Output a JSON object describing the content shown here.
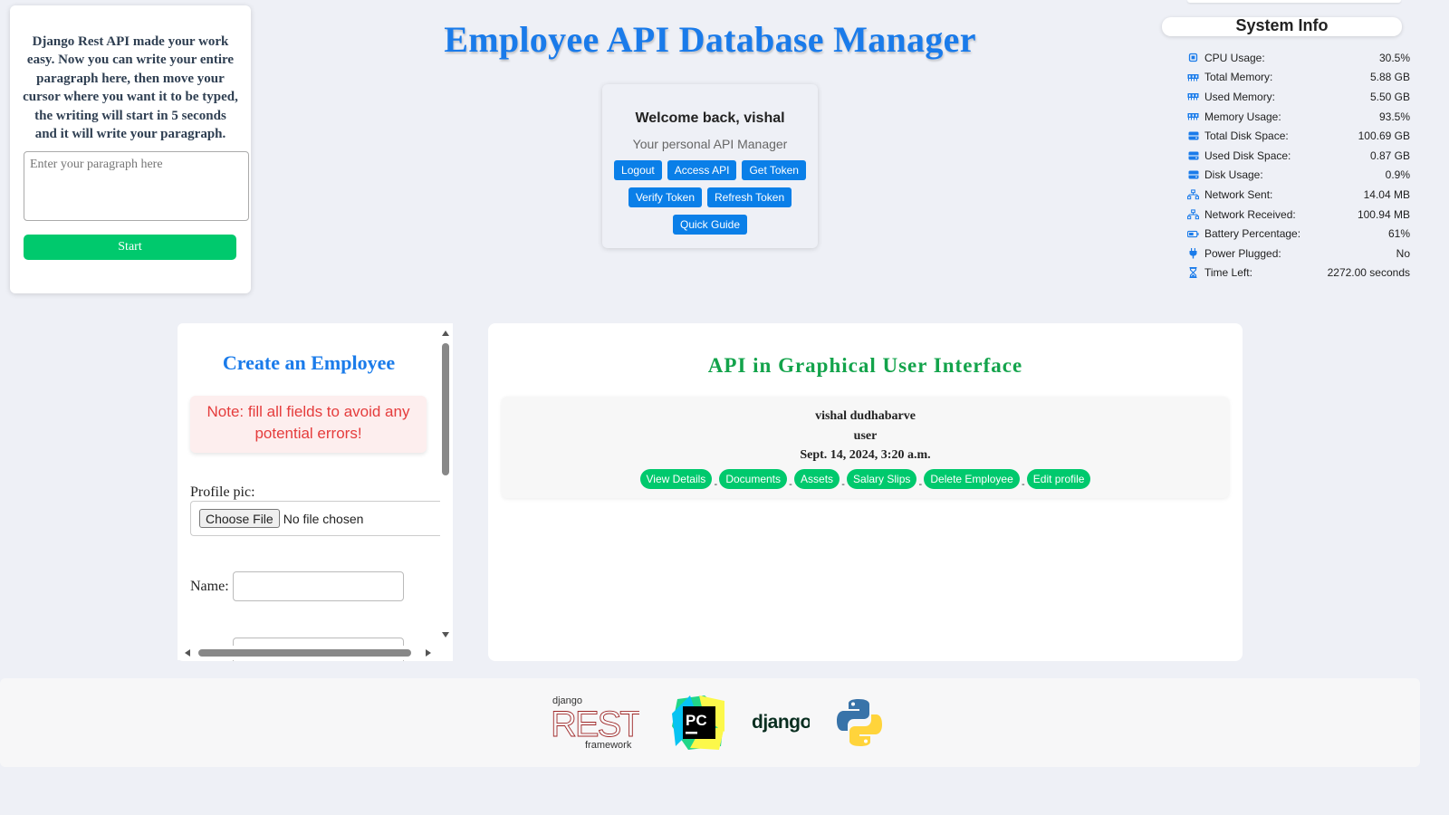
{
  "typer": {
    "description": "Django Rest API made your work easy. Now you can write your entire paragraph here, then move your cursor where you want it to be typed, the writing will start in 5 seconds and it will write your paragraph.",
    "placeholder": "Enter your paragraph here",
    "start_label": "Start"
  },
  "header": {
    "title": "Employee API Database Manager"
  },
  "welcome": {
    "title": "Welcome back, vishal",
    "subtitle": "Your personal API Manager",
    "buttons": {
      "logout": "Logout",
      "access_api": "Access API",
      "get_token": "Get Token",
      "verify_token": "Verify Token",
      "refresh_token": "Refresh Token",
      "quick_guide": "Quick Guide"
    }
  },
  "system_info": {
    "title": "System Info",
    "rows": [
      {
        "icon": "cpu-icon",
        "label": "CPU Usage:",
        "value": "30.5%"
      },
      {
        "icon": "memory-icon",
        "label": "Total Memory:",
        "value": "5.88 GB"
      },
      {
        "icon": "memory-icon",
        "label": "Used Memory:",
        "value": "5.50 GB"
      },
      {
        "icon": "memory-icon",
        "label": "Memory Usage:",
        "value": "93.5%"
      },
      {
        "icon": "disk-icon",
        "label": "Total Disk Space:",
        "value": "100.69 GB"
      },
      {
        "icon": "disk-icon",
        "label": "Used Disk Space:",
        "value": "0.87 GB"
      },
      {
        "icon": "disk-icon",
        "label": "Disk Usage:",
        "value": "0.9%"
      },
      {
        "icon": "network-icon",
        "label": "Network Sent:",
        "value": "14.04 MB"
      },
      {
        "icon": "network-icon",
        "label": "Network Received:",
        "value": "100.94 MB"
      },
      {
        "icon": "battery-icon",
        "label": "Battery Percentage:",
        "value": "61%"
      },
      {
        "icon": "plug-icon",
        "label": "Power Plugged:",
        "value": "No"
      },
      {
        "icon": "hourglass-icon",
        "label": "Time Left:",
        "value": "2272.00 seconds"
      }
    ]
  },
  "create_employee": {
    "title": "Create an Employee",
    "note": "Note: fill all fields to avoid any potential errors!",
    "profile_pic_label": "Profile pic:",
    "choose_file_label": "Choose File",
    "no_file_text": "No file chosen",
    "name_label": "Name:"
  },
  "gui": {
    "title": "API in Graphical User Interface",
    "employee": {
      "name": "vishal dudhabarve",
      "role": "user",
      "date": "Sept. 14, 2024, 3:20 a.m."
    },
    "actions": {
      "view_details": "View Details",
      "documents": "Documents",
      "assets": "Assets",
      "salary_slips": "Salary Slips",
      "delete_employee": "Delete Employee",
      "edit_profile": "Edit profile"
    },
    "separator": "-"
  },
  "footer": {
    "drf_logo": {
      "top": "django",
      "main": "REST",
      "bottom": "framework"
    },
    "pycharm_logo": "PC",
    "django_logo": "django"
  },
  "colors": {
    "primary_blue": "#1a7bea",
    "button_blue": "#0a7fe8",
    "green": "#00c96d",
    "gui_title_green": "#13a34b",
    "note_red": "#e53c3c"
  }
}
